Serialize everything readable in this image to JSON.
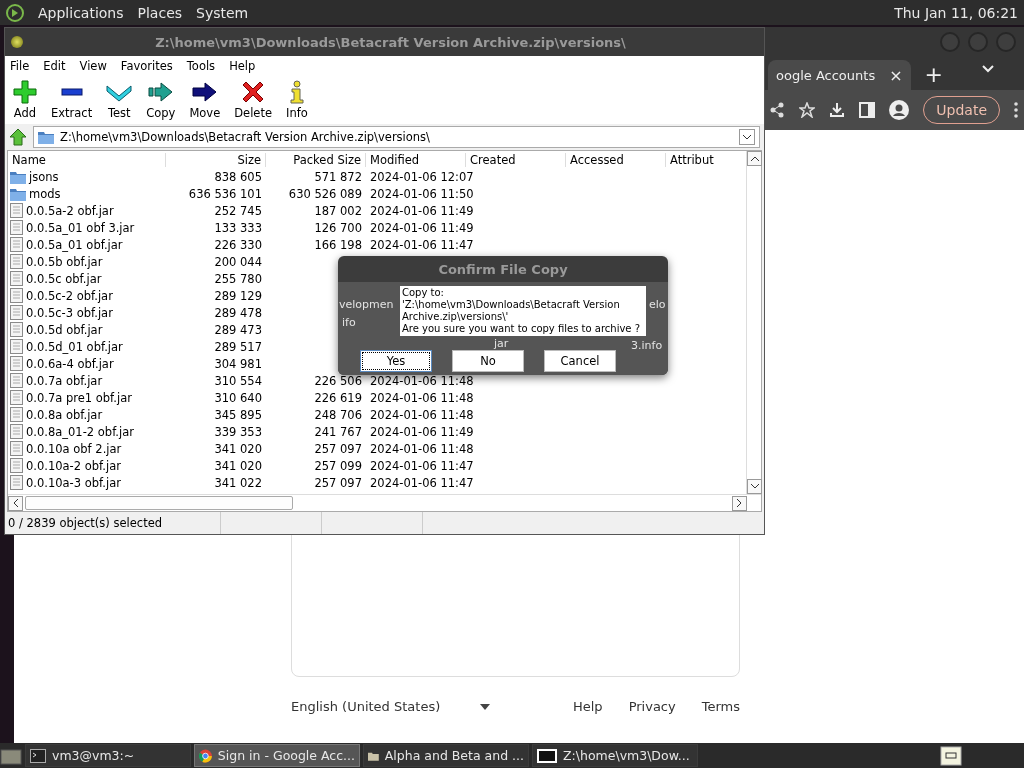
{
  "top_panel": {
    "menus": [
      "Applications",
      "Places",
      "System"
    ],
    "clock": "Thu Jan 11, 06:21"
  },
  "browser": {
    "tab": "oogle Accounts",
    "tab_close": "×",
    "new_tab": "+",
    "update_button": "Update",
    "footer": {
      "language": "English (United States)",
      "links": [
        "Help",
        "Privacy",
        "Terms"
      ]
    }
  },
  "archive_window": {
    "title": "Z:\\home\\vm3\\Downloads\\Betacraft Version Archive.zip\\versions\\",
    "menu": [
      "File",
      "Edit",
      "View",
      "Favorites",
      "Tools",
      "Help"
    ],
    "toolbar": [
      {
        "label": "Add",
        "kind": "add"
      },
      {
        "label": "Extract",
        "kind": "extract"
      },
      {
        "label": "Test",
        "kind": "test"
      },
      {
        "label": "Copy",
        "kind": "copy"
      },
      {
        "label": "Move",
        "kind": "move"
      },
      {
        "label": "Delete",
        "kind": "delete"
      },
      {
        "label": "Info",
        "kind": "info"
      }
    ],
    "address": "Z:\\home\\vm3\\Downloads\\Betacraft Version Archive.zip\\versions\\",
    "columns": [
      "Name",
      "Size",
      "Packed Size",
      "Modified",
      "Created",
      "Accessed",
      "Attribut"
    ],
    "rows": [
      {
        "kind": "folder",
        "name": "jsons",
        "size": "838 605",
        "packed_size": "571 872",
        "modified": "2024-01-06 12:07"
      },
      {
        "kind": "folder",
        "name": "mods",
        "size": "636 536 101",
        "packed_size": "630 526 089",
        "modified": "2024-01-06 11:50"
      },
      {
        "kind": "file",
        "name": "0.0.5a-2 obf.jar",
        "size": "252 745",
        "packed_size": "187 002",
        "modified": "2024-01-06 11:49"
      },
      {
        "kind": "file",
        "name": "0.0.5a_01 obf 3.jar",
        "size": "133 333",
        "packed_size": "126 700",
        "modified": "2024-01-06 11:49"
      },
      {
        "kind": "file",
        "name": "0.0.5a_01 obf.jar",
        "size": "226 330",
        "packed_size": "166 198",
        "modified": "2024-01-06 11:47"
      },
      {
        "kind": "file",
        "name": "0.0.5b obf.jar",
        "size": "200 044"
      },
      {
        "kind": "file",
        "name": "0.0.5c obf.jar",
        "size": "255 780"
      },
      {
        "kind": "file",
        "name": "0.0.5c-2 obf.jar",
        "size": "289 129"
      },
      {
        "kind": "file",
        "name": "0.0.5c-3 obf.jar",
        "size": "289 478"
      },
      {
        "kind": "file",
        "name": "0.0.5d obf.jar",
        "size": "289 473"
      },
      {
        "kind": "file",
        "name": "0.0.5d_01 obf.jar",
        "size": "289 517"
      },
      {
        "kind": "file",
        "name": "0.0.6a-4 obf.jar",
        "size": "304 981"
      },
      {
        "kind": "file",
        "name": "0.0.7a obf.jar",
        "size": "310 554",
        "packed_size": "226 506",
        "modified": "2024-01-06 11:48"
      },
      {
        "kind": "file",
        "name": "0.0.7a pre1 obf.jar",
        "size": "310 640",
        "packed_size": "226 619",
        "modified": "2024-01-06 11:48"
      },
      {
        "kind": "file",
        "name": "0.0.8a obf.jar",
        "size": "345 895",
        "packed_size": "248 706",
        "modified": "2024-01-06 11:48"
      },
      {
        "kind": "file",
        "name": "0.0.8a_01-2 obf.jar",
        "size": "339 353",
        "packed_size": "241 767",
        "modified": "2024-01-06 11:49"
      },
      {
        "kind": "file",
        "name": "0.0.10a obf 2.jar",
        "size": "341 020",
        "packed_size": "257 097",
        "modified": "2024-01-06 11:48"
      },
      {
        "kind": "file",
        "name": "0.0.10a-2 obf.jar",
        "size": "341 020",
        "packed_size": "257 099",
        "modified": "2024-01-06 11:47"
      },
      {
        "kind": "file",
        "name": "0.0.10a-3 obf.jar",
        "size": "341 022",
        "packed_size": "257 097",
        "modified": "2024-01-06 11:47"
      }
    ],
    "status_bar": [
      "0 / 2839 object(s) selected"
    ]
  },
  "dialog": {
    "title": "Confirm File Copy",
    "message_lines": [
      "Copy to:",
      "'Z:\\home\\vm3\\Downloads\\Betacraft Version",
      "Archive.zip\\versions\\'",
      "Are you sure you want to copy files to archive ?"
    ],
    "background_texts": [
      "velopmen",
      "ifo",
      "jar",
      "elo",
      "3.info"
    ],
    "buttons": [
      {
        "label": "Yes",
        "selected": true
      },
      {
        "label": "No",
        "selected": false
      },
      {
        "label": "Cancel",
        "selected": false
      }
    ]
  },
  "taskbar": {
    "tasks": [
      {
        "label": "vm3@vm3:~",
        "kind": "terminal",
        "selected": false
      },
      {
        "label": "Sign in - Google Acc...",
        "kind": "browser",
        "selected": true
      },
      {
        "label": "Alpha and Beta and ...",
        "kind": "folder",
        "selected": false
      },
      {
        "label": "Z:\\home\\vm3\\Dow...",
        "kind": "archiver",
        "selected": false
      }
    ]
  }
}
